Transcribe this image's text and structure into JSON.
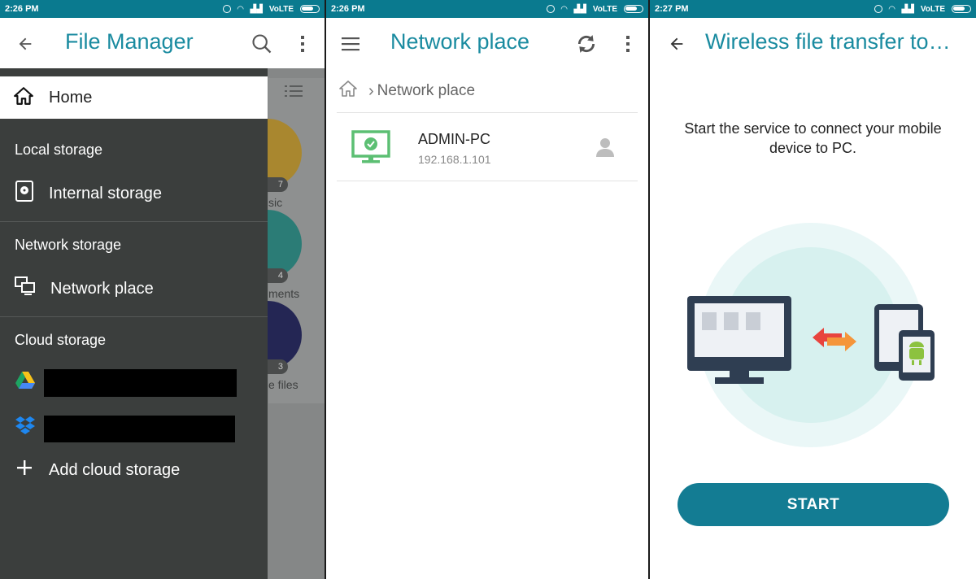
{
  "colors": {
    "status_bar": "#0a7a8f",
    "accent": "#1a8ba0",
    "drawer": "#3b3e3d",
    "start_button": "#137c93",
    "online_green": "#5cbf73"
  },
  "status_bar": {
    "left": {
      "time": "2:26 PM",
      "network": "VoLTE"
    },
    "middle": {
      "time": "2:26 PM",
      "network": "VoLTE"
    },
    "right": {
      "time": "2:27 PM",
      "network": "VoLTE"
    }
  },
  "file_manager": {
    "title": "File Manager",
    "icons": [
      "back-arrow-icon",
      "search-icon",
      "more-vert-icon",
      "list-view-icon"
    ],
    "background_labels": [
      "sic",
      "ments",
      "e files"
    ],
    "background_counts": [
      "7",
      "4",
      "3"
    ],
    "drawer": {
      "home_label": "Home",
      "local_storage": {
        "title": "Local storage",
        "items": [
          "Internal storage"
        ]
      },
      "network_storage": {
        "title": "Network storage",
        "items": [
          "Network place"
        ]
      },
      "cloud_storage": {
        "title": "Cloud storage",
        "add_label": "Add cloud storage",
        "providers": [
          "google-drive-icon",
          "dropbox-icon"
        ]
      }
    }
  },
  "network_place": {
    "title": "Network place",
    "breadcrumb": {
      "current": "Network place"
    },
    "devices": [
      {
        "name": "ADMIN-PC",
        "ip": "192.168.1.101"
      }
    ]
  },
  "wireless_transfer": {
    "title": "Wireless file transfer to…",
    "description": "Start the service to connect your mobile device to PC.",
    "start_label": "START"
  }
}
